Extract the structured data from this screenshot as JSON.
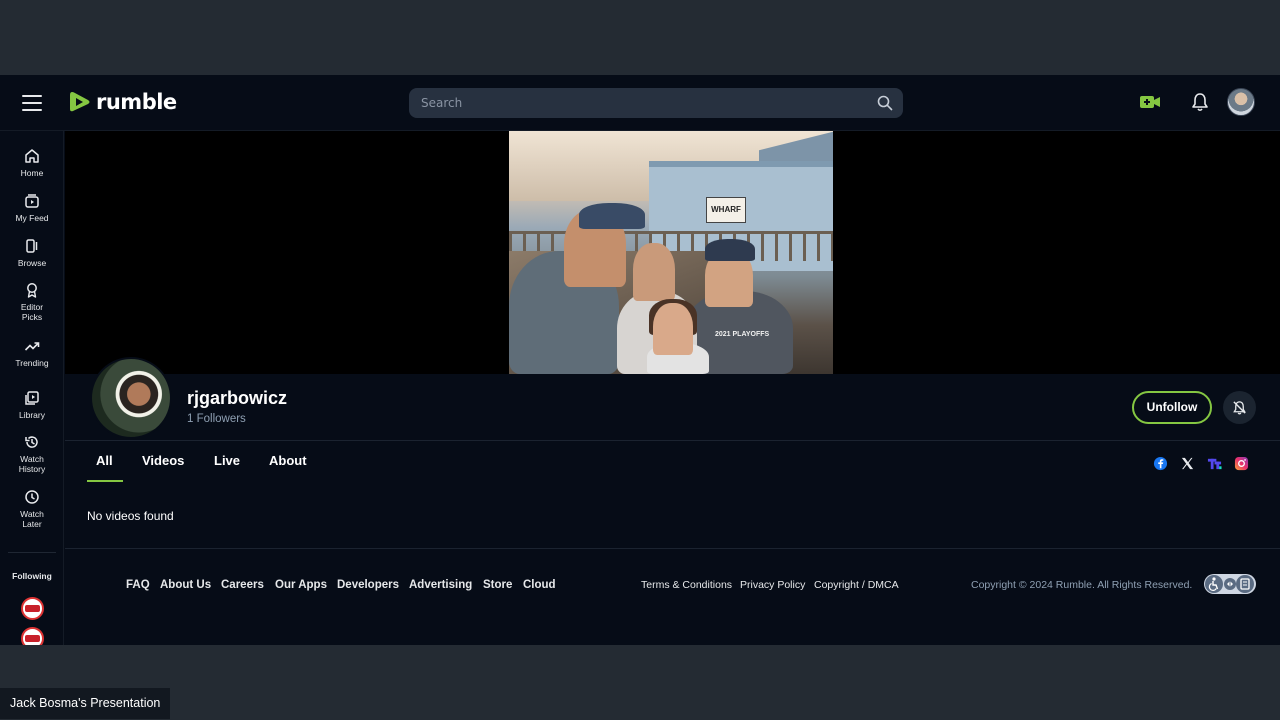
{
  "header": {
    "logo_text": "rumble",
    "search_placeholder": "Search"
  },
  "sidebar": {
    "items": [
      {
        "label": "Home",
        "icon": "home-icon"
      },
      {
        "label": "My Feed",
        "icon": "feed-icon"
      },
      {
        "label": "Browse",
        "icon": "browse-icon"
      },
      {
        "label": "Editor Picks",
        "icon": "award-icon"
      },
      {
        "label": "Trending",
        "icon": "trending-icon"
      },
      {
        "label": "Library",
        "icon": "library-icon"
      },
      {
        "label": "Watch History",
        "icon": "history-icon"
      },
      {
        "label": "Watch Later",
        "icon": "clock-icon"
      }
    ],
    "following_label": "Following"
  },
  "banner": {
    "sign_text": "WHARF",
    "shirt_text": "2021 PLAYOFFS"
  },
  "channel": {
    "name": "rjgarbowicz",
    "followers": "1 Followers",
    "unfollow_label": "Unfollow"
  },
  "tabs": [
    {
      "label": "All",
      "active": true
    },
    {
      "label": "Videos",
      "active": false
    },
    {
      "label": "Live",
      "active": false
    },
    {
      "label": "About",
      "active": false
    }
  ],
  "social_icons": [
    "facebook-icon",
    "x-icon",
    "truth-social-icon",
    "instagram-icon"
  ],
  "content": {
    "empty_message": "No videos found"
  },
  "footer": {
    "links": [
      "FAQ",
      "About Us",
      "Careers",
      "Our Apps",
      "Developers",
      "Advertising",
      "Store",
      "Cloud"
    ],
    "legal_links": [
      "Terms & Conditions",
      "Privacy Policy",
      "Copyright / DMCA"
    ],
    "copyright": "Copyright © 2024 Rumble. All Rights Reserved."
  },
  "presenter_label": "Jack Bosma's Presentation",
  "colors": {
    "accent": "#85c742",
    "background": "#060c17",
    "outer": "#242b33"
  }
}
